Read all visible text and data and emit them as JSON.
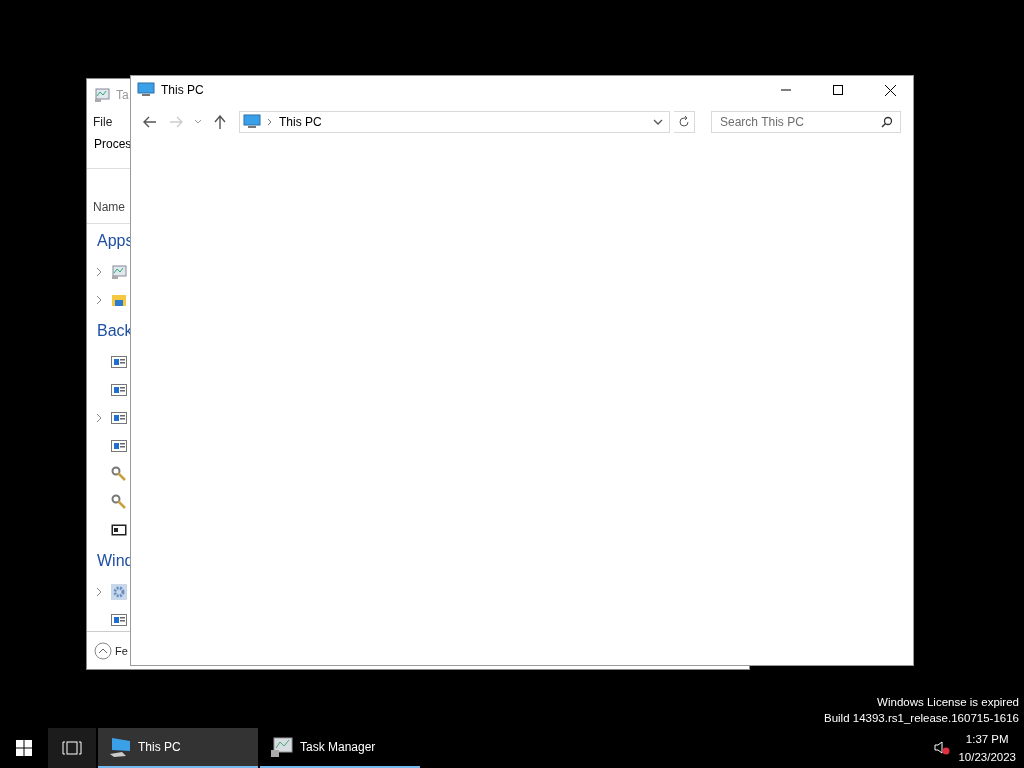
{
  "task_manager": {
    "title": "Ta",
    "menu": [
      "File"
    ],
    "tab": "Proces",
    "column": "Name",
    "groups": [
      {
        "label": "Apps",
        "rows": [
          {
            "expandable": true,
            "kind": "chart"
          },
          {
            "expandable": true,
            "kind": "folder"
          }
        ]
      },
      {
        "label": "Back",
        "rows": [
          {
            "expandable": false,
            "kind": "service"
          },
          {
            "expandable": false,
            "kind": "service"
          },
          {
            "expandable": true,
            "kind": "service"
          },
          {
            "expandable": false,
            "kind": "service"
          },
          {
            "expandable": false,
            "kind": "key"
          },
          {
            "expandable": false,
            "kind": "key"
          },
          {
            "expandable": false,
            "kind": "console"
          }
        ]
      },
      {
        "label": "Wind",
        "rows": [
          {
            "expandable": true,
            "kind": "gear"
          },
          {
            "expandable": false,
            "kind": "service"
          }
        ]
      }
    ],
    "footer": "Fe"
  },
  "explorer": {
    "title": "This PC",
    "back_disabled": false,
    "forward_disabled": true,
    "address": "This PC",
    "search": {
      "placeholder": "Search This PC"
    }
  },
  "desktop_notice": [
    "Windows License is expired",
    "Build 14393.rs1_release.160715-1616"
  ],
  "taskbar": {
    "items": [
      {
        "label": "This PC",
        "kind": "pc",
        "selected": true
      },
      {
        "label": "Task Manager",
        "kind": "taskmgr",
        "selected": false
      }
    ],
    "volume": {
      "muted": true
    },
    "clock": {
      "time": "1:37 PM",
      "date": "10/23/2023"
    }
  }
}
